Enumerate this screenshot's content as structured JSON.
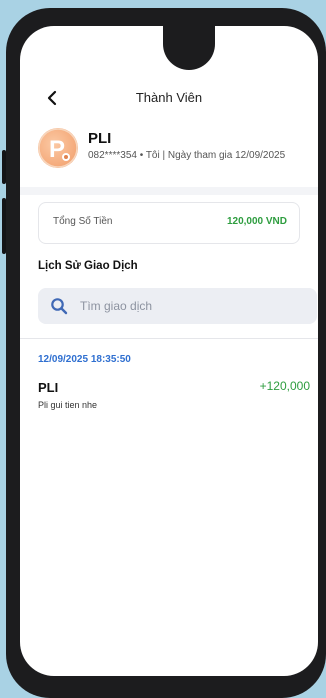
{
  "header": {
    "title": "Thành Viên"
  },
  "profile": {
    "name": "PLI",
    "meta": "082****354 • Tôi | Ngày tham gia 12/09/2025",
    "avatar_letter": "P"
  },
  "summary": {
    "label": "Tổng Số Tiền",
    "value": "120,000 VND"
  },
  "history": {
    "title": "Lịch Sử Giao Dịch",
    "search_placeholder": "Tìm giao dịch",
    "transactions": [
      {
        "time": "12/09/2025 18:35:50",
        "name": "PLI",
        "amount": "+120,000",
        "note": "Pli gui tien nhe"
      }
    ]
  },
  "colors": {
    "positive": "#2e9d3f",
    "date": "#2f6fd0",
    "avatar": "#f4a878"
  },
  "icons": {
    "back": "chevron-left-icon",
    "search": "search-icon"
  }
}
